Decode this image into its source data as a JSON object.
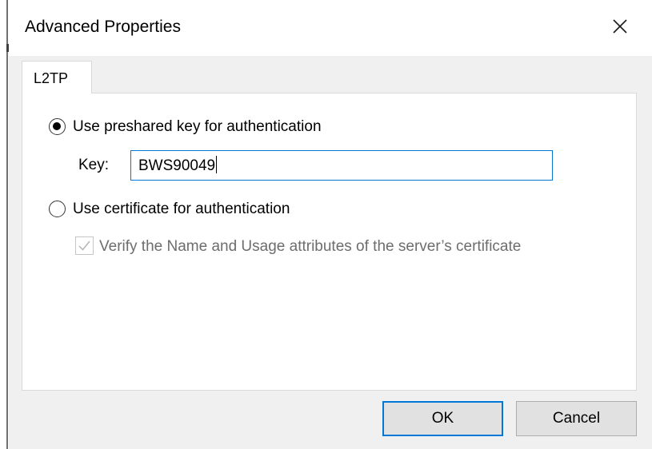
{
  "dialog": {
    "title": "Advanced Properties",
    "close_icon": "close-icon"
  },
  "tabs": [
    {
      "label": "L2TP",
      "selected": true
    }
  ],
  "l2tp": {
    "preshared_radio": {
      "label": "Use preshared key for authentication",
      "checked": true
    },
    "key": {
      "label": "Key:",
      "value": "BWS90049"
    },
    "certificate_radio": {
      "label": "Use certificate for authentication",
      "checked": false
    },
    "verify_checkbox": {
      "label": "Verify the Name and Usage attributes of the server’s certificate",
      "checked": true,
      "disabled": true
    }
  },
  "buttons": {
    "ok_label": "OK",
    "cancel_label": "Cancel"
  },
  "colors": {
    "focus_accent": "#0078d7",
    "disabled_text": "#6d6d6d",
    "dialog_background": "#f0f0f0",
    "panel_background": "#ffffff"
  }
}
